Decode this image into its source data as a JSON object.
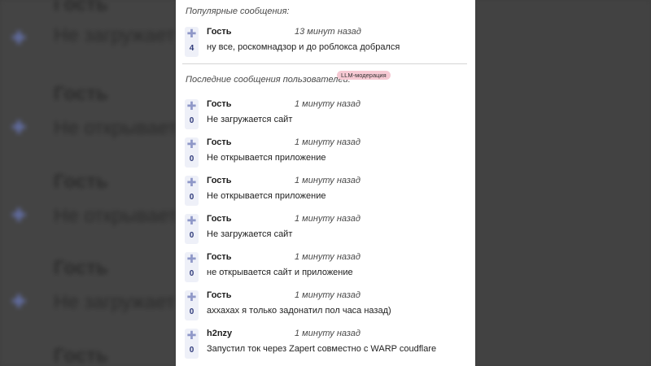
{
  "background": {
    "rows": [
      {
        "name": "Гость",
        "text": "Не загружается сайт"
      },
      {
        "name": "Гость",
        "text": "Не открывается приложение"
      },
      {
        "name": "Гость",
        "text": "Не открывается приложение"
      },
      {
        "name": "Гость",
        "text": "Не загружается сайт"
      },
      {
        "name": "Гость",
        "text": ""
      }
    ]
  },
  "popular": {
    "title": "Популярные сообщения:",
    "messages": [
      {
        "author": "Гость",
        "time": "13 минут назад",
        "votes": "4",
        "text": "ну все, роскомнадзор и до роблокса добрался"
      }
    ]
  },
  "recent": {
    "title": "Последние сообщения пользователей:",
    "badge": "LLM-модерация",
    "messages": [
      {
        "author": "Гость",
        "time": "1 минуту назад",
        "votes": "0",
        "text": "Не загружается сайт"
      },
      {
        "author": "Гость",
        "time": "1 минуту назад",
        "votes": "0",
        "text": "Не открывается приложение"
      },
      {
        "author": "Гость",
        "time": "1 минуту назад",
        "votes": "0",
        "text": "Не открывается приложение"
      },
      {
        "author": "Гость",
        "time": "1 минуту назад",
        "votes": "0",
        "text": "Не загружается сайт"
      },
      {
        "author": "Гость",
        "time": "1 минуту назад",
        "votes": "0",
        "text": "не открывается сайт и приложение"
      },
      {
        "author": "Гость",
        "time": "1 минуту назад",
        "votes": "0",
        "text": "аххахах я только задонатил пол часа назад)"
      },
      {
        "author": "h2nzy",
        "time": "1 минуту назад",
        "votes": "0",
        "text": "Запустил ток через Zapert совместно с WARP coudflare"
      }
    ]
  },
  "icons": {
    "upvote": "plus-icon"
  },
  "colors": {
    "badge_bg": "#f6c9d3",
    "vote_bg": "#eef0f8",
    "vote_icon": "#8f98c8",
    "vote_count": "#2f3a7a"
  }
}
